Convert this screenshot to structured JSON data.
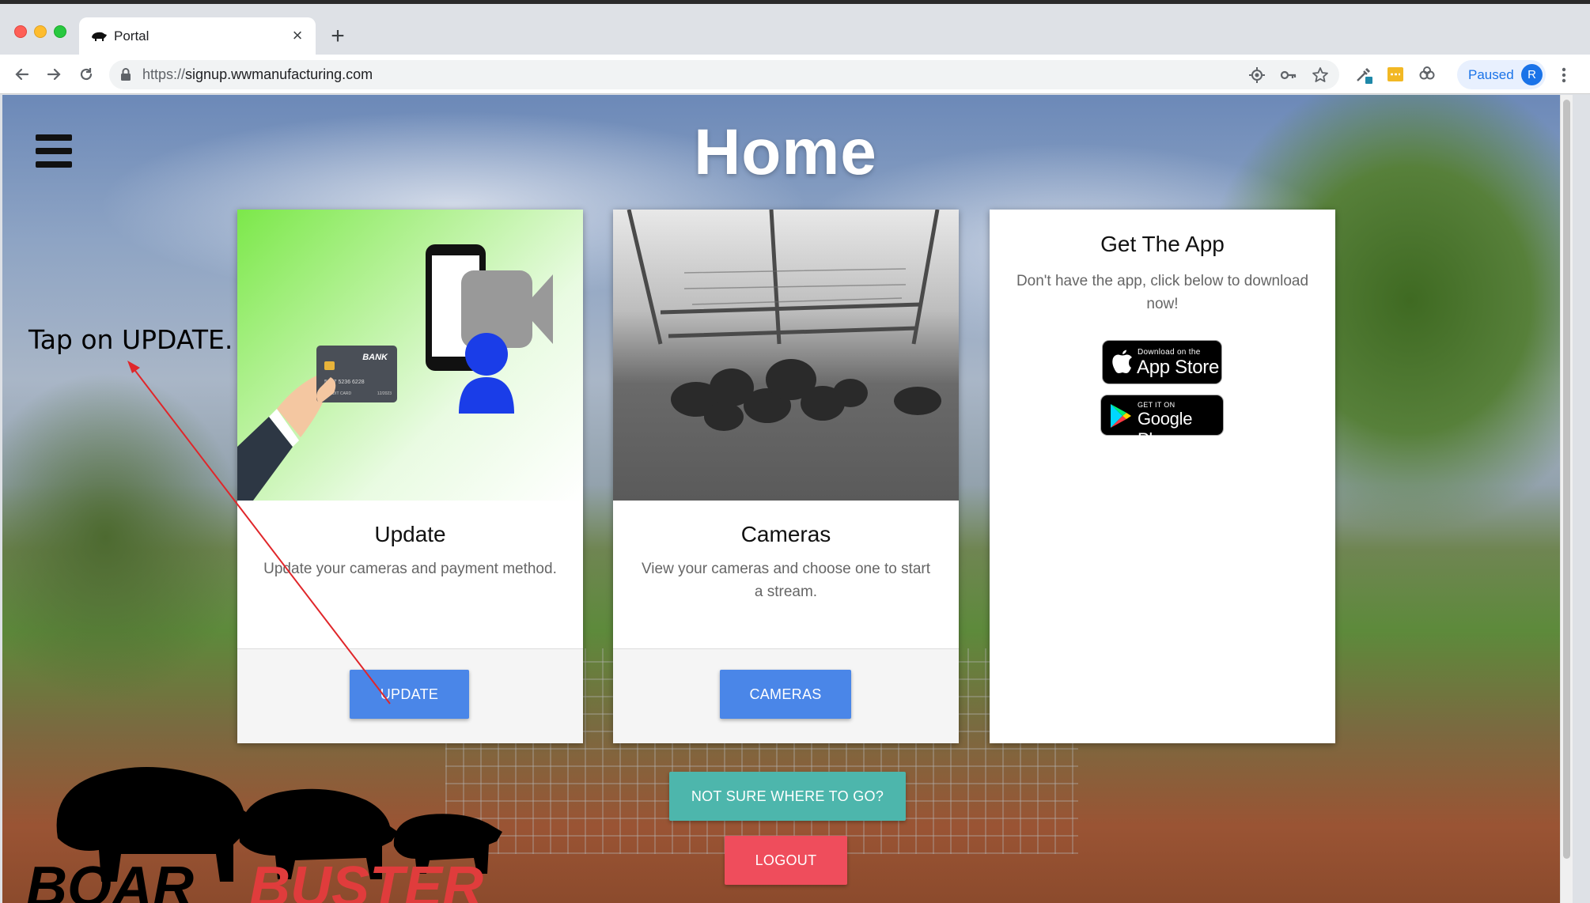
{
  "browser": {
    "tab_title": "Portal",
    "tab_favicon": "boar-favicon",
    "new_tab_symbol": "+",
    "close_symbol": "×",
    "url_scheme": "https://",
    "url_host": "signup.wwmanufacturing.com",
    "profile_status": "Paused",
    "profile_initial": "R"
  },
  "page": {
    "title": "Home",
    "menu_icon": "hamburger-menu-icon"
  },
  "cards": {
    "update": {
      "title": "Update",
      "text": "Update your cameras and payment method.",
      "button": "UPDATE",
      "image_icons": [
        "credit-card-icon",
        "phone-icon",
        "video-camera-icon",
        "person-icon"
      ],
      "card_brand": "BANK",
      "card_number": "5897  5236  6228",
      "card_footer_left": "CREDIT CARD",
      "card_footer_right": "12/2023"
    },
    "cameras": {
      "title": "Cameras",
      "text": "View your cameras and choose one to start a stream.",
      "button": "CAMERAS"
    },
    "app": {
      "title": "Get The App",
      "text": "Don't have the app, click below to download now!",
      "appstore_small": "Download on the",
      "appstore_big": "App Store",
      "googleplay_small": "GET IT ON",
      "googleplay_big": "Google Play"
    }
  },
  "footer_buttons": {
    "help": "NOT SURE WHERE TO GO?",
    "logout": "LOGOUT"
  },
  "annotation": {
    "text": "Tap on UPDATE."
  },
  "logo": {
    "text_left": "BOAR",
    "text_right": "BUSTER"
  },
  "colors": {
    "primary_button": "#4a86e8",
    "help_button": "#4db6ac",
    "logout_button": "#ef4d5c",
    "annotation_arrow": "#e0262a",
    "logo_red": "#e03c3c"
  }
}
